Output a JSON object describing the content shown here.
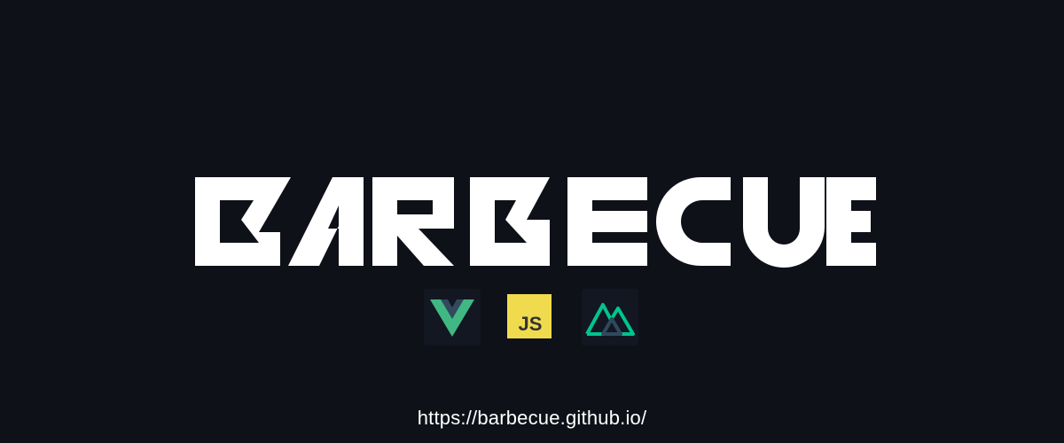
{
  "logo": {
    "wordmark": "BARBECUE",
    "color": "#ffffff"
  },
  "background": "#0e1118",
  "tech_icons": [
    {
      "name": "vue-icon",
      "colors": [
        "#41b883",
        "#34495e"
      ]
    },
    {
      "name": "javascript-icon",
      "text": "JS",
      "colors": [
        "#f0db4f",
        "#323330"
      ]
    },
    {
      "name": "nuxt-icon",
      "colors": [
        "#00c58e",
        "#2f495e"
      ]
    }
  ],
  "footer": {
    "url": "https://barbecue.github.io/"
  }
}
